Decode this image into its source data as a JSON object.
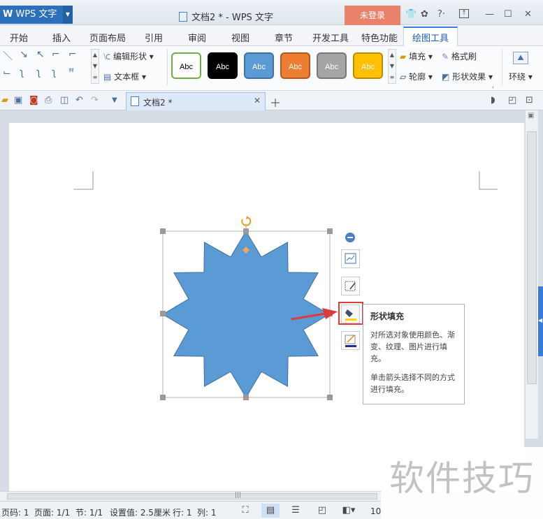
{
  "app": {
    "name": "WPS 文字",
    "doc_title": "文档2 * - WPS 文字",
    "login": "未登录"
  },
  "window_icons": {
    "shirt": "shirt-icon",
    "chat": "chat-icon",
    "help": "?·",
    "restore": "restore-icon",
    "minimize": "—",
    "maximize": "☐",
    "close": "✕"
  },
  "menu": {
    "tabs": [
      "开始",
      "插入",
      "页面布局",
      "引用",
      "审阅",
      "视图",
      "章节",
      "开发工具",
      "特色功能",
      "绘图工具"
    ],
    "active": "绘图工具"
  },
  "ribbon": {
    "edit_shape": "编辑形状",
    "text_box": "文本框",
    "styles": [
      {
        "label": "Abc",
        "bg": "#ffffff",
        "fg": "#000000",
        "border": "#70ad47"
      },
      {
        "label": "Abc",
        "bg": "#000000",
        "fg": "#ffffff",
        "border": "#000000"
      },
      {
        "label": "Abc",
        "bg": "#5b9bd5",
        "fg": "#ffffff",
        "border": "#41719c"
      },
      {
        "label": "Abc",
        "bg": "#ed7d31",
        "fg": "#ffffff",
        "border": "#ae5a21"
      },
      {
        "label": "Abc",
        "bg": "#a5a5a5",
        "fg": "#ffffff",
        "border": "#787878"
      },
      {
        "label": "Abc",
        "bg": "#ffc000",
        "fg": "#ffffff",
        "border": "#bc8c00"
      }
    ],
    "fill": "填充",
    "outline": "轮廓",
    "format_painter": "格式刷",
    "shape_effects": "形状效果",
    "wrap": "环绕"
  },
  "document": {
    "tab_label": "文档2 *"
  },
  "shape": {
    "fill_color": "#5b9bd5"
  },
  "tooltip": {
    "title": "形状填充",
    "body1": "对所选对象使用颜色、渐变、纹理、图片进行填充。",
    "body2": "单击箭头选择不同的方式进行填充。"
  },
  "status": {
    "page_num": "页码: 1",
    "pages": "页面: 1/1",
    "section": "节: 1/1",
    "setting": "设置值: 2.5厘米",
    "row": "行: 1",
    "col": "列: 1",
    "zoom": "10"
  },
  "watermark": "软件技巧"
}
